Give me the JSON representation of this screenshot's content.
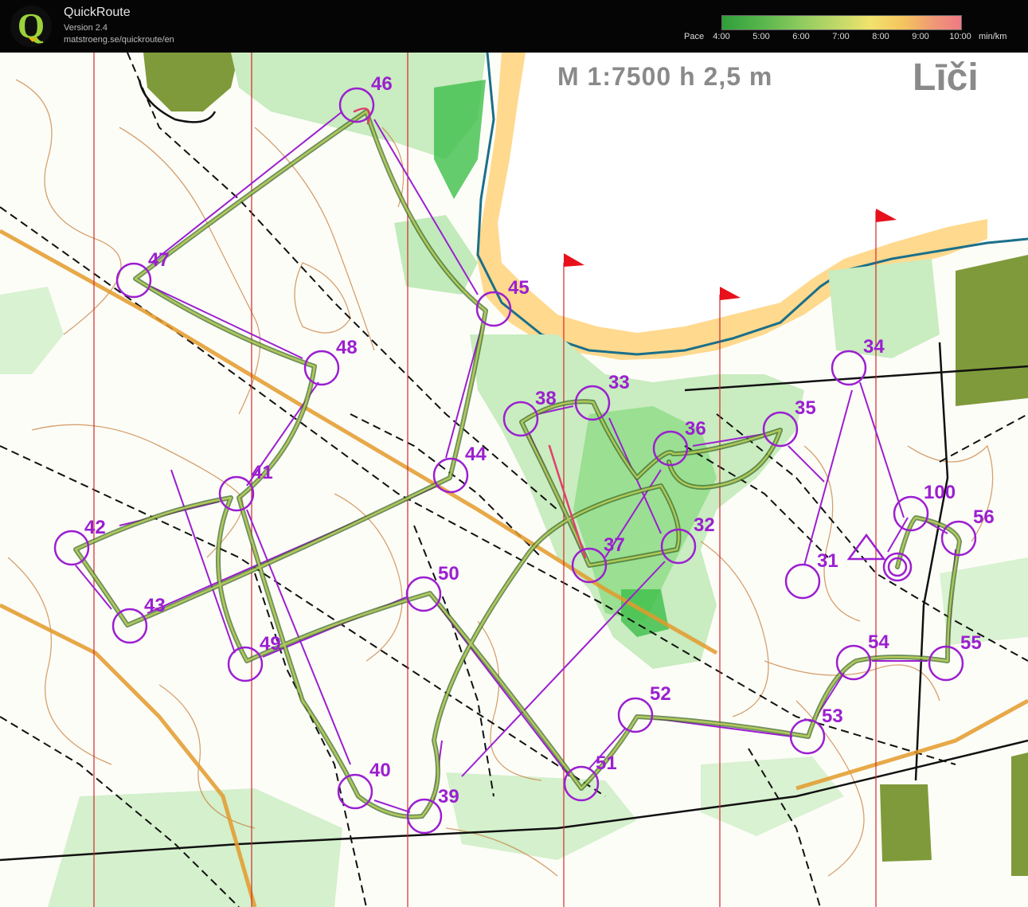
{
  "app": {
    "name": "QuickRoute",
    "version": "Version 2.4",
    "url": "matstroeng.se/quickroute/en",
    "logo_letter": "Q",
    "logo_icon": "quickroute-logo-icon"
  },
  "pace_legend": {
    "label": "Pace",
    "ticks": [
      "4:00",
      "5:00",
      "6:00",
      "7:00",
      "8:00",
      "9:00",
      "10:00"
    ],
    "unit": "min/km",
    "gradient_colors": [
      "#2f9e3a",
      "#5cb84e",
      "#8fcb5e",
      "#c6da6a",
      "#f2e36c",
      "#f5c45e",
      "#f09a75",
      "#ef7a85"
    ]
  },
  "map": {
    "scale_text": "M 1:7500 h 2,5 m",
    "place_name": "Līči",
    "colors": {
      "forest": "#ffffff",
      "green_light": "#c9ecc0",
      "green_mid": "#8fdc86",
      "green_dark": "#3fbf4a",
      "sea": "#ffffff",
      "sand": "#ffd27a",
      "building_area": "#7f9a3a",
      "contour": "#b5651d",
      "course": "#9b1fd0",
      "route": "#6f8f3f",
      "path": "#111111",
      "water_edge": "#1a6f8a",
      "flag": "#e8101a"
    },
    "controls": [
      "31",
      "32",
      "33",
      "34",
      "35",
      "36",
      "37",
      "38",
      "39",
      "40",
      "41",
      "42",
      "43",
      "44",
      "45",
      "46",
      "47",
      "48",
      "49",
      "50",
      "51",
      "52",
      "53",
      "54",
      "55",
      "56",
      "100"
    ]
  }
}
